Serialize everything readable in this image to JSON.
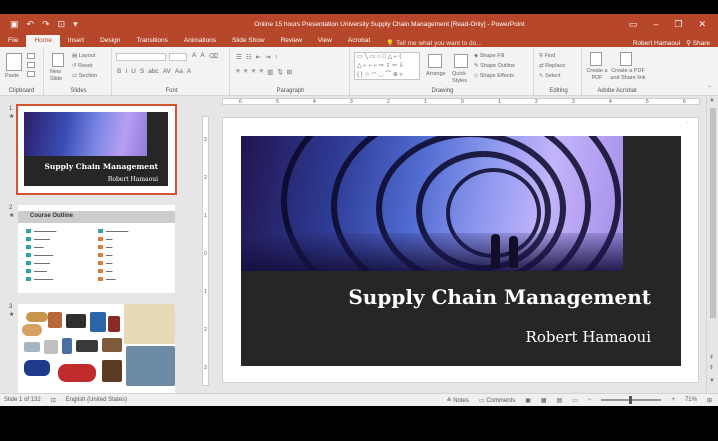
{
  "app": {
    "window_title": "Online 15 hours Presentation University Supply Chain Management [Read-Only] - PowerPoint",
    "user": "Robert Hamaoui",
    "share": "Share"
  },
  "ribbon_tabs": [
    "File",
    "Home",
    "Insert",
    "Design",
    "Transitions",
    "Animations",
    "Slide Show",
    "Review",
    "View",
    "Acrobat"
  ],
  "active_tab": "Home",
  "tell_me": "Tell me what you want to do...",
  "ribbon": {
    "groups": {
      "clipboard": "Clipboard",
      "slides": "Slides",
      "font": "Font",
      "paragraph": "Paragraph",
      "drawing": "Drawing",
      "editing": "Editing",
      "adobe": "Adobe Acrobat"
    },
    "paste": "Paste",
    "new_slide": "New Slide",
    "layout": "Layout",
    "reset": "Reset",
    "section": "Section",
    "arrange": "Arrange",
    "quick_styles": "Quick Styles",
    "shape_fill": "Shape Fill",
    "shape_outline": "Shape Outline",
    "shape_effects": "Shape Effects",
    "find": "Find",
    "replace": "Replace",
    "select": "Select",
    "create_pdf": "Create a PDF",
    "create_pdf_share": "Create a PDF and Share link"
  },
  "thumbnails": {
    "slide1": {
      "num": "1",
      "title": "Supply Chain Management",
      "subtitle": "Robert Hamaoui"
    },
    "slide2": {
      "num": "2",
      "title": "Course Outline"
    },
    "slide3": {
      "num": "3"
    }
  },
  "slide": {
    "title": "Supply Chain Management",
    "subtitle": "Robert Hamaoui"
  },
  "ruler_h": [
    "6",
    "5",
    "4",
    "3",
    "2",
    "1",
    "0",
    "1",
    "2",
    "3",
    "4",
    "5",
    "6"
  ],
  "ruler_v": [
    "3",
    "2",
    "1",
    "0",
    "1",
    "2",
    "3"
  ],
  "status": {
    "slide_count": "Slide 1 of 132",
    "language": "English (United States)",
    "notes": "Notes",
    "comments": "Comments",
    "zoom": "71%"
  }
}
